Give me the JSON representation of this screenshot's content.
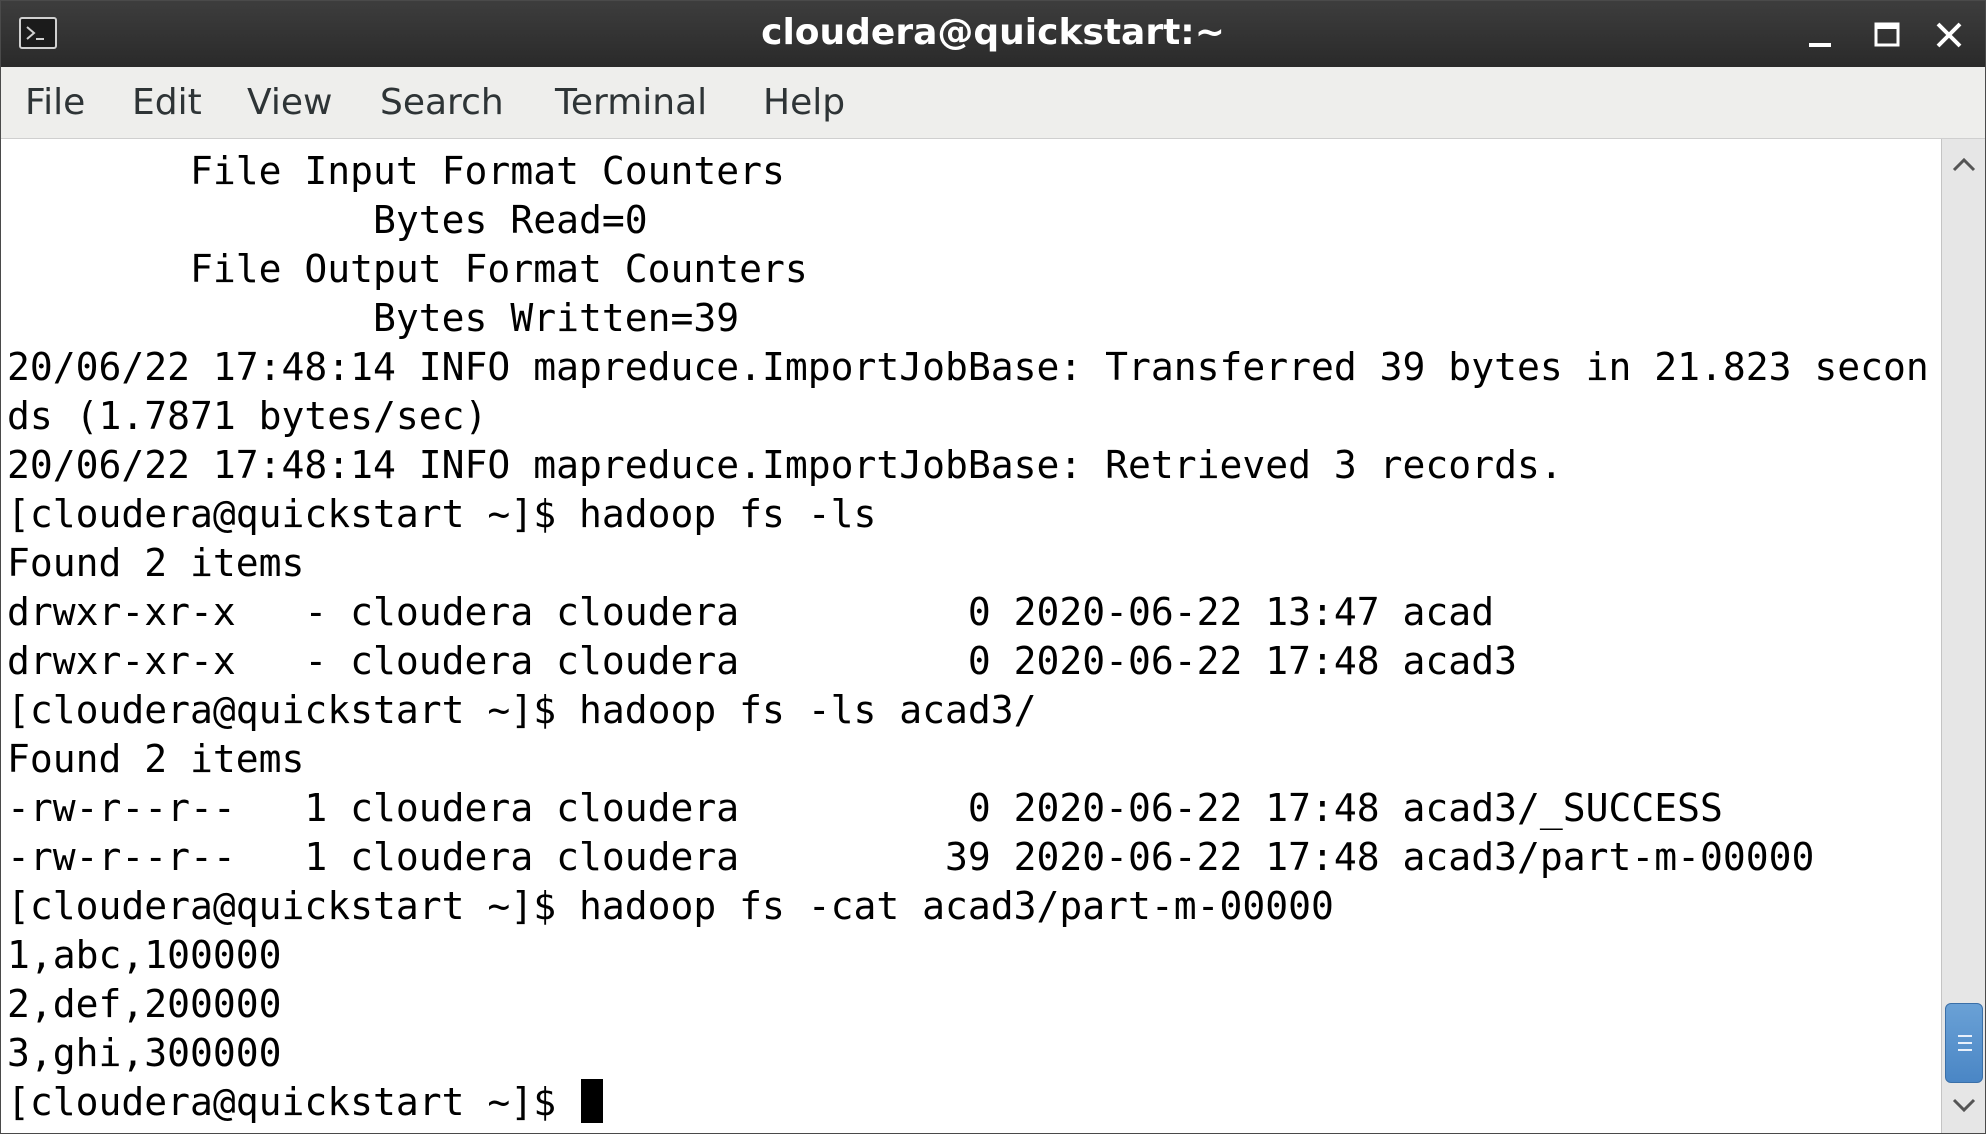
{
  "window": {
    "title": "cloudera@quickstart:~"
  },
  "menu": {
    "file": "File",
    "edit": "Edit",
    "view": "View",
    "search": "Search",
    "terminal": "Terminal",
    "help": "Help"
  },
  "terminal": {
    "lines": [
      "        File Input Format Counters ",
      "                Bytes Read=0",
      "        File Output Format Counters ",
      "                Bytes Written=39",
      "20/06/22 17:48:14 INFO mapreduce.ImportJobBase: Transferred 39 bytes in 21.823 secon",
      "ds (1.7871 bytes/sec)",
      "20/06/22 17:48:14 INFO mapreduce.ImportJobBase: Retrieved 3 records.",
      "[cloudera@quickstart ~]$ hadoop fs -ls",
      "Found 2 items",
      "drwxr-xr-x   - cloudera cloudera          0 2020-06-22 13:47 acad",
      "drwxr-xr-x   - cloudera cloudera          0 2020-06-22 17:48 acad3",
      "[cloudera@quickstart ~]$ hadoop fs -ls acad3/",
      "Found 2 items",
      "-rw-r--r--   1 cloudera cloudera          0 2020-06-22 17:48 acad3/_SUCCESS",
      "-rw-r--r--   1 cloudera cloudera         39 2020-06-22 17:48 acad3/part-m-00000",
      "[cloudera@quickstart ~]$ hadoop fs -cat acad3/part-m-00000",
      "1,abc,100000",
      "2,def,200000",
      "3,ghi,300000"
    ],
    "prompt": "[cloudera@quickstart ~]$ "
  },
  "icons": {
    "app": "terminal-icon",
    "minimize": "minimize-icon",
    "maximize": "maximize-icon",
    "close": "close-icon",
    "scroll_up": "chevron-up-icon",
    "scroll_down": "chevron-down-icon"
  },
  "colors": {
    "titlebar": "#2f2f2f",
    "menubar": "#eeeeec",
    "terminal_bg": "#ffffff",
    "terminal_fg": "#000000",
    "scroll_thumb": "#4a86c5"
  }
}
